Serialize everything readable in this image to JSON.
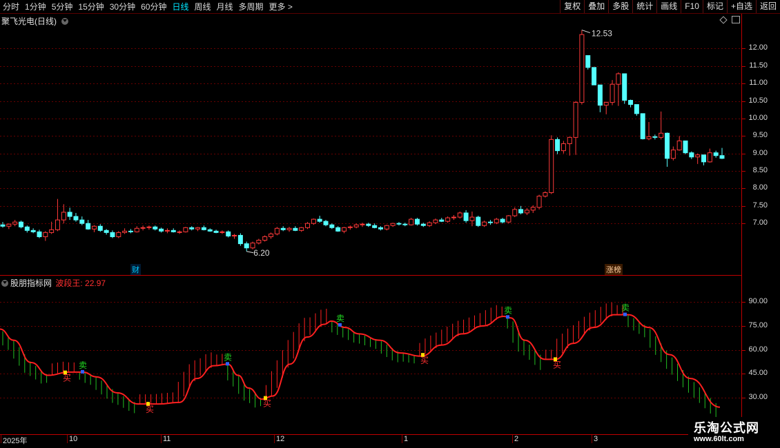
{
  "toolbar": {
    "periods": [
      "分时",
      "1分钟",
      "5分钟",
      "15分钟",
      "30分钟",
      "60分钟",
      "日线",
      "周线",
      "月线",
      "多周期",
      "更多 >"
    ],
    "active_period": "日线",
    "right_buttons": [
      "复权",
      "叠加",
      "多股",
      "统计",
      "画线",
      "F10",
      "标记",
      "+自选",
      "返回"
    ]
  },
  "main_panel": {
    "stock_name": "聚飞光电",
    "period_label": "(日线)",
    "high_label": "12.53",
    "low_label": "6.20",
    "event_badges": [
      "财",
      "涨榜"
    ],
    "y_ticks": [
      "12.00",
      "11.50",
      "11.00",
      "10.50",
      "10.00",
      "9.50",
      "9.00",
      "8.50",
      "8.00",
      "7.50",
      "7.00"
    ]
  },
  "indicator_panel": {
    "source": "股朋指标网",
    "name": "波段王:",
    "value": "22.97",
    "y_ticks": [
      "90.00",
      "75.00",
      "60.00",
      "45.00",
      "30.00"
    ],
    "buy_label": "买",
    "sell_label": "卖"
  },
  "x_axis": [
    "2025年",
    "10",
    "11",
    "12",
    "1",
    "2",
    "3"
  ],
  "watermark": {
    "line1": "乐淘公式网",
    "line2": "www.60lt.com"
  },
  "colors": {
    "up": "#ff3a3a",
    "down": "#54ffff",
    "grid": "#6a0000",
    "ind_line": "#ff2020",
    "ind_up": "#ff2020",
    "ind_down": "#22c022",
    "sell": "#22dd22",
    "buy": "#ff3030"
  },
  "chart_data": {
    "type": "candlestick",
    "price_range": [
      5.9,
      12.6
    ],
    "ohlc": [
      [
        6.96,
        7.04,
        6.88,
        6.92
      ],
      [
        6.92,
        7.0,
        6.84,
        6.98
      ],
      [
        6.98,
        7.1,
        6.92,
        7.04
      ],
      [
        7.04,
        7.08,
        6.86,
        6.9
      ],
      [
        6.9,
        6.94,
        6.74,
        6.8
      ],
      [
        6.8,
        6.86,
        6.72,
        6.76
      ],
      [
        6.76,
        6.82,
        6.58,
        6.62
      ],
      [
        6.62,
        6.78,
        6.5,
        6.74
      ],
      [
        6.74,
        7.05,
        6.7,
        6.82
      ],
      [
        6.82,
        7.7,
        6.78,
        7.1
      ],
      [
        7.1,
        7.55,
        7.0,
        7.32
      ],
      [
        7.32,
        7.45,
        7.1,
        7.2
      ],
      [
        7.2,
        7.3,
        7.05,
        7.1
      ],
      [
        7.1,
        7.2,
        6.95,
        7.0
      ],
      [
        7.0,
        7.1,
        6.82,
        6.84
      ],
      [
        6.84,
        6.95,
        6.75,
        6.92
      ],
      [
        6.92,
        6.98,
        6.76,
        6.8
      ],
      [
        6.8,
        6.84,
        6.68,
        6.74
      ],
      [
        6.74,
        6.8,
        6.58,
        6.62
      ],
      [
        6.62,
        6.78,
        6.58,
        6.74
      ],
      [
        6.74,
        6.86,
        6.7,
        6.78
      ],
      [
        6.78,
        6.84,
        6.72,
        6.76
      ],
      [
        6.76,
        6.92,
        6.74,
        6.86
      ],
      [
        6.86,
        6.94,
        6.8,
        6.88
      ],
      [
        6.88,
        6.94,
        6.82,
        6.9
      ],
      [
        6.9,
        6.94,
        6.8,
        6.84
      ],
      [
        6.84,
        6.88,
        6.74,
        6.78
      ],
      [
        6.78,
        6.86,
        6.72,
        6.8
      ],
      [
        6.8,
        6.86,
        6.74,
        6.76
      ],
      [
        6.76,
        6.8,
        6.7,
        6.76
      ],
      [
        6.76,
        6.9,
        6.74,
        6.88
      ],
      [
        6.88,
        6.92,
        6.8,
        6.84
      ],
      [
        6.84,
        6.9,
        6.78,
        6.88
      ],
      [
        6.88,
        6.94,
        6.8,
        6.82
      ],
      [
        6.82,
        6.86,
        6.76,
        6.78
      ],
      [
        6.78,
        6.82,
        6.72,
        6.74
      ],
      [
        6.74,
        6.8,
        6.7,
        6.76
      ],
      [
        6.76,
        6.8,
        6.6,
        6.64
      ],
      [
        6.64,
        6.7,
        6.56,
        6.66
      ],
      [
        6.66,
        6.72,
        6.36,
        6.42
      ],
      [
        6.42,
        6.48,
        6.2,
        6.3
      ],
      [
        6.3,
        6.48,
        6.26,
        6.44
      ],
      [
        6.44,
        6.56,
        6.4,
        6.52
      ],
      [
        6.52,
        6.66,
        6.48,
        6.62
      ],
      [
        6.62,
        6.74,
        6.56,
        6.7
      ],
      [
        6.7,
        6.9,
        6.66,
        6.86
      ],
      [
        6.86,
        6.92,
        6.78,
        6.82
      ],
      [
        6.82,
        6.9,
        6.76,
        6.86
      ],
      [
        6.86,
        6.92,
        6.78,
        6.8
      ],
      [
        6.8,
        6.9,
        6.76,
        6.88
      ],
      [
        6.88,
        7.04,
        6.84,
        7.0
      ],
      [
        7.0,
        7.14,
        6.96,
        7.12
      ],
      [
        7.12,
        7.22,
        7.02,
        7.06
      ],
      [
        7.06,
        7.1,
        6.92,
        6.96
      ],
      [
        6.96,
        7.0,
        6.84,
        6.88
      ],
      [
        6.88,
        6.92,
        6.76,
        6.78
      ],
      [
        6.78,
        6.9,
        6.72,
        6.88
      ],
      [
        6.88,
        6.94,
        6.82,
        6.9
      ],
      [
        6.9,
        7.0,
        6.86,
        6.96
      ],
      [
        6.96,
        7.02,
        6.9,
        6.98
      ],
      [
        6.98,
        7.02,
        6.9,
        6.94
      ],
      [
        6.94,
        7.0,
        6.86,
        6.88
      ],
      [
        6.88,
        6.92,
        6.8,
        6.84
      ],
      [
        6.84,
        6.96,
        6.8,
        6.94
      ],
      [
        6.94,
        7.02,
        6.9,
        7.0
      ],
      [
        7.0,
        7.04,
        6.94,
        6.98
      ],
      [
        6.98,
        7.02,
        6.92,
        6.96
      ],
      [
        6.96,
        7.16,
        6.94,
        7.12
      ],
      [
        7.12,
        7.16,
        6.94,
        6.98
      ],
      [
        6.98,
        7.02,
        6.9,
        6.94
      ],
      [
        6.94,
        7.06,
        6.9,
        7.02
      ],
      [
        7.02,
        7.14,
        6.98,
        7.1
      ],
      [
        7.1,
        7.16,
        7.04,
        7.06
      ],
      [
        7.06,
        7.2,
        7.02,
        7.16
      ],
      [
        7.16,
        7.24,
        7.1,
        7.18
      ],
      [
        7.18,
        7.34,
        7.14,
        7.3
      ],
      [
        7.3,
        7.38,
        7.02,
        7.08
      ],
      [
        7.08,
        7.34,
        6.92,
        7.18
      ],
      [
        7.18,
        7.22,
        6.9,
        6.94
      ],
      [
        6.94,
        7.08,
        6.9,
        7.04
      ],
      [
        7.04,
        7.1,
        6.96,
        7.02
      ],
      [
        7.02,
        7.16,
        6.98,
        7.12
      ],
      [
        7.12,
        7.16,
        7.0,
        7.04
      ],
      [
        7.04,
        7.24,
        7.0,
        7.22
      ],
      [
        7.22,
        7.46,
        7.18,
        7.4
      ],
      [
        7.4,
        7.5,
        7.26,
        7.3
      ],
      [
        7.3,
        7.44,
        7.24,
        7.38
      ],
      [
        7.38,
        7.52,
        7.3,
        7.46
      ],
      [
        7.46,
        7.82,
        7.4,
        7.78
      ],
      [
        7.78,
        7.92,
        7.74,
        7.88
      ],
      [
        7.88,
        9.52,
        7.84,
        9.4
      ],
      [
        9.4,
        9.46,
        8.98,
        9.08
      ],
      [
        9.08,
        9.36,
        9.0,
        9.28
      ],
      [
        9.28,
        9.48,
        8.94,
        9.46
      ],
      [
        9.46,
        10.5,
        8.96,
        10.46
      ],
      [
        10.46,
        12.53,
        10.4,
        12.4
      ],
      [
        11.8,
        11.8,
        11.4,
        11.46
      ],
      [
        11.46,
        11.46,
        10.96,
        10.96
      ],
      [
        10.96,
        10.96,
        10.18,
        10.38
      ],
      [
        10.38,
        10.48,
        10.12,
        10.46
      ],
      [
        10.46,
        11.1,
        10.38,
        10.98
      ],
      [
        10.98,
        11.32,
        10.36,
        11.28
      ],
      [
        11.28,
        11.28,
        10.42,
        10.52
      ],
      [
        10.52,
        10.54,
        10.32,
        10.4
      ],
      [
        10.4,
        10.4,
        10.08,
        10.14
      ],
      [
        10.14,
        10.14,
        9.4,
        9.42
      ],
      [
        9.42,
        9.9,
        9.38,
        9.48
      ],
      [
        9.48,
        9.54,
        9.4,
        9.46
      ],
      [
        9.46,
        10.2,
        9.4,
        9.58
      ],
      [
        9.58,
        9.6,
        8.62,
        8.86
      ],
      [
        8.86,
        9.2,
        8.8,
        9.1
      ],
      [
        9.1,
        9.5,
        9.08,
        9.36
      ],
      [
        9.36,
        9.36,
        8.98,
        9.02
      ],
      [
        9.02,
        9.06,
        8.84,
        8.9
      ],
      [
        8.9,
        9.0,
        8.7,
        8.96
      ],
      [
        8.96,
        8.96,
        8.66,
        8.76
      ],
      [
        8.76,
        9.14,
        8.74,
        9.02
      ],
      [
        9.02,
        9.08,
        8.88,
        8.94
      ],
      [
        8.94,
        9.16,
        8.84,
        8.86
      ]
    ],
    "indicator_range": [
      20,
      100
    ],
    "indicator_line": [
      [
        0,
        73
      ],
      [
        20,
        66
      ],
      [
        45,
        52
      ],
      [
        70,
        44
      ],
      [
        100,
        46
      ],
      [
        120,
        46
      ],
      [
        140,
        43
      ],
      [
        170,
        33
      ],
      [
        200,
        26
      ],
      [
        230,
        26
      ],
      [
        260,
        27
      ],
      [
        285,
        42
      ],
      [
        310,
        50
      ],
      [
        330,
        51
      ],
      [
        345,
        44
      ],
      [
        360,
        36
      ],
      [
        380,
        29
      ],
      [
        395,
        31
      ],
      [
        420,
        51
      ],
      [
        445,
        68
      ],
      [
        470,
        76
      ],
      [
        480,
        78
      ],
      [
        500,
        74
      ],
      [
        520,
        70
      ],
      [
        550,
        66
      ],
      [
        580,
        58
      ],
      [
        610,
        56
      ],
      [
        640,
        63
      ],
      [
        670,
        70
      ],
      [
        700,
        75
      ],
      [
        730,
        81
      ],
      [
        740,
        80
      ],
      [
        760,
        66
      ],
      [
        790,
        54
      ],
      [
        805,
        54
      ],
      [
        830,
        64
      ],
      [
        860,
        74
      ],
      [
        890,
        82
      ],
      [
        910,
        82
      ],
      [
        940,
        74
      ],
      [
        970,
        57
      ],
      [
        1000,
        42
      ],
      [
        1043,
        24
      ]
    ],
    "sell_signals": [
      120,
      330,
      493,
      736,
      906
    ],
    "buy_signals": [
      95,
      215,
      385,
      613,
      805
    ]
  }
}
